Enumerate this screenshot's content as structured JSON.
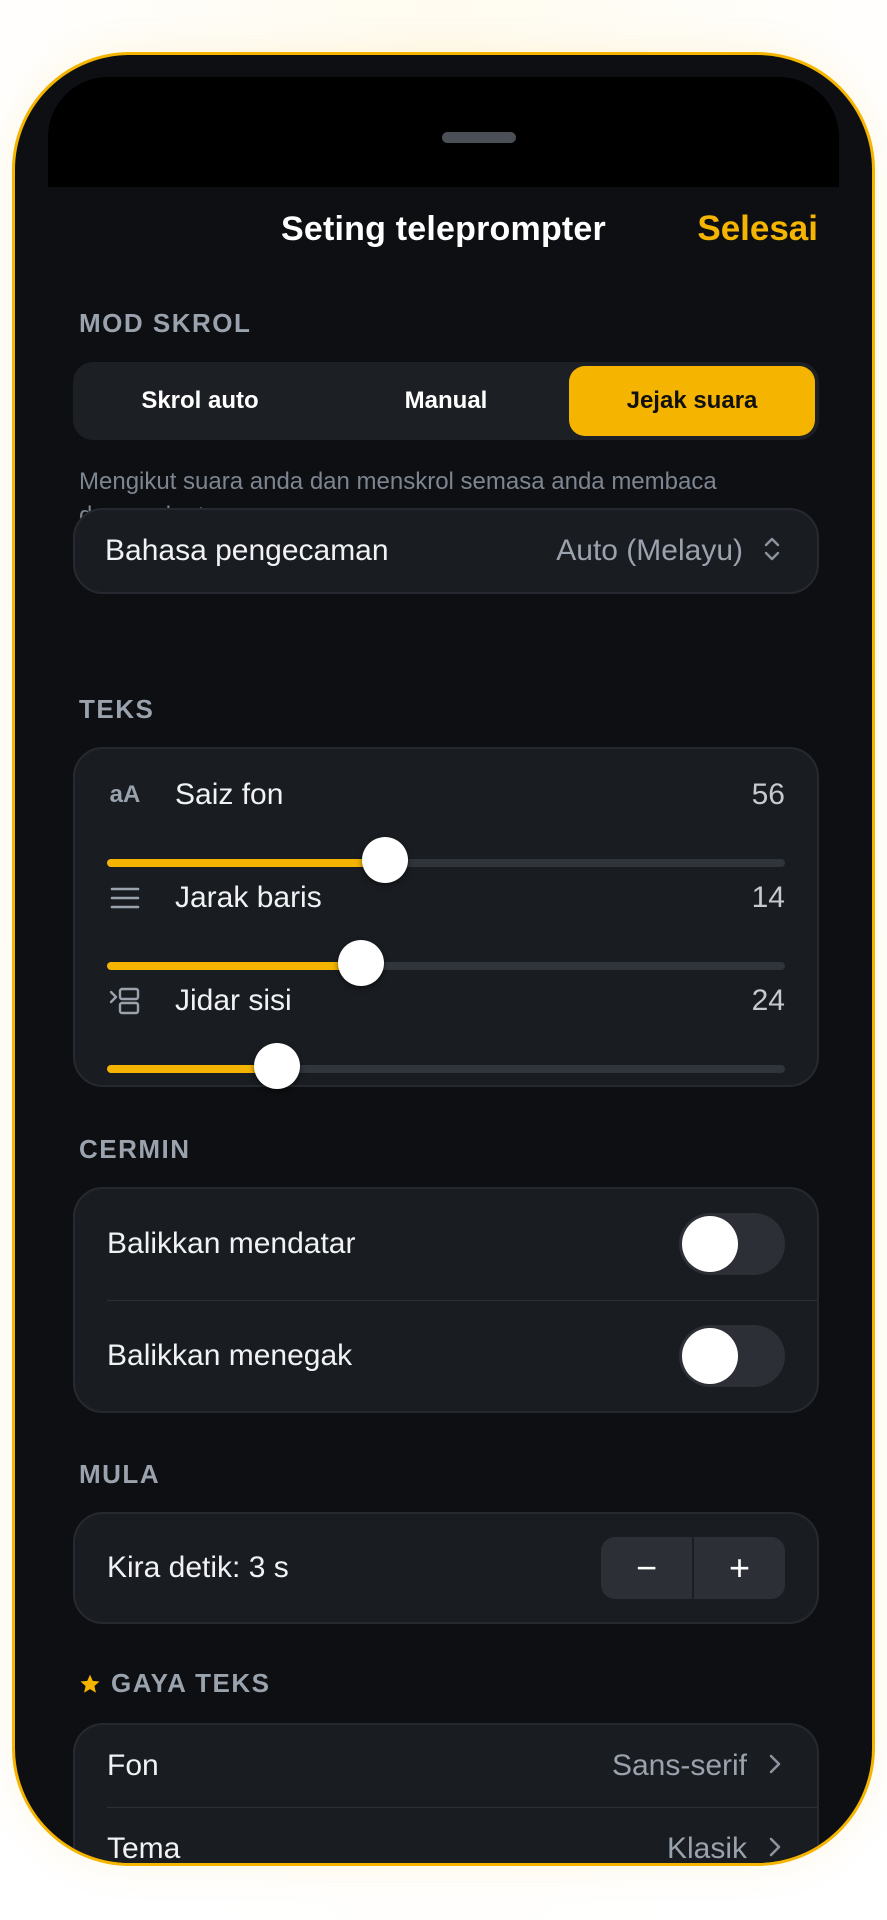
{
  "header": {
    "title": "Seting teleprompter",
    "done_label": "Selesai"
  },
  "scroll_mode": {
    "section_label": "MOD SKROL",
    "options": [
      "Skrol auto",
      "Manual",
      "Jejak suara"
    ],
    "selected": "Jejak suara",
    "description": "Mengikut suara anda dan menskrol semasa anda membaca dengan lantang.",
    "language": {
      "label": "Bahasa pengecaman",
      "value": "Auto (Melayu)"
    }
  },
  "text": {
    "section_label": "TEKS",
    "sliders": [
      {
        "label": "Saiz fon",
        "value": "56",
        "icon": "font-size-icon",
        "fill_percent": 41
      },
      {
        "label": "Jarak baris",
        "value": "14",
        "icon": "line-spacing-icon",
        "fill_percent": 37.5
      },
      {
        "label": "Jidar sisi",
        "value": "24",
        "icon": "side-margin-icon",
        "fill_percent": 25
      }
    ]
  },
  "mirror": {
    "section_label": "CERMIN",
    "rows": [
      {
        "label": "Balikkan mendatar",
        "on": false
      },
      {
        "label": "Balikkan menegak",
        "on": false
      }
    ]
  },
  "start": {
    "section_label": "MULA",
    "countdown_label": "Kira detik: 3 s",
    "minus": "−",
    "plus": "+"
  },
  "text_style": {
    "section_label": "GAYA TEKS",
    "rows": [
      {
        "label": "Fon",
        "value": "Sans-serif"
      },
      {
        "label": "Tema",
        "value": "Klasik"
      }
    ]
  },
  "colors": {
    "accent": "#f4b400",
    "background": "#0d0f12",
    "card": "#191c21"
  }
}
